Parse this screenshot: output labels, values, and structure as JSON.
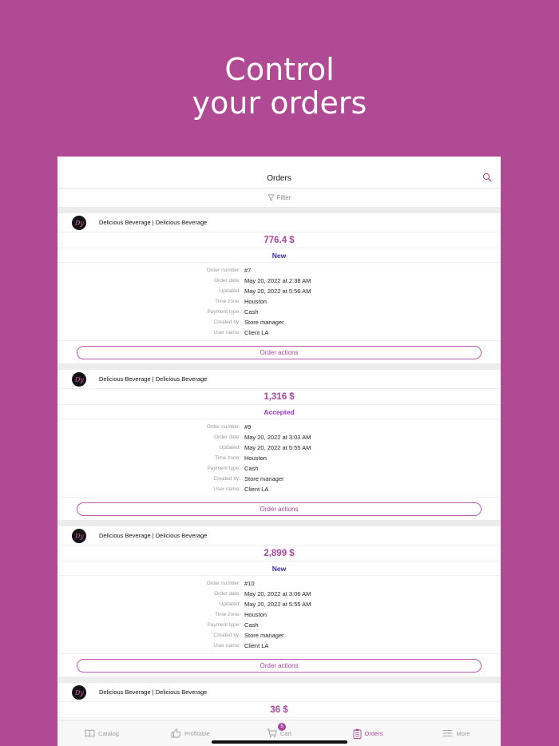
{
  "hero": {
    "line1": "Control",
    "line2": "your orders"
  },
  "nav": {
    "title": "Orders"
  },
  "filter": {
    "label": "Filter"
  },
  "labels": {
    "order_number": "Order number:",
    "order_date": "Order date:",
    "updated": "Updated:",
    "time_zone": "Time zone:",
    "payment_type": "Payment type:",
    "created_by": "Created by:",
    "user_name": "User name:",
    "actions": "Order actions"
  },
  "orders": [
    {
      "store": "Delicious Beverage  | Delicious Beverage",
      "amount": "776.4 $",
      "status": "New",
      "status_color": "#3b2fa3",
      "number": "#7",
      "date": "May 20, 2022 at 2:38 AM",
      "updated": "May 20, 2022 at 5:56 AM",
      "tz": "Houston",
      "payment": "Cash",
      "created_by": "Store manager",
      "user": "Client LA"
    },
    {
      "store": "Delicious Beverage  | Delicious Beverage",
      "amount": "1,316 $",
      "status": "Accepted",
      "status_color": "#a235c9",
      "number": "#9",
      "date": "May 20, 2022 at 3:03 AM",
      "updated": "May 20, 2022 at 5:55 AM",
      "tz": "Houston",
      "payment": "Cash",
      "created_by": "Store manager",
      "user": "Client LA"
    },
    {
      "store": "Delicious Beverage  | Delicious Beverage",
      "amount": "2,899 $",
      "status": "New",
      "status_color": "#3b2fa3",
      "number": "#10",
      "date": "May 20, 2022 at 3:06 AM",
      "updated": "May 20, 2022 at 5:55 AM",
      "tz": "Houston",
      "payment": "Cash",
      "created_by": "Store manager",
      "user": "Client LA"
    },
    {
      "store": "Delicious Beverage  | Delicious Beverage",
      "amount": "36 $"
    }
  ],
  "tabs": [
    {
      "label": "Catalog",
      "icon": "book-icon"
    },
    {
      "label": "Profitable",
      "icon": "thumbs-up-icon"
    },
    {
      "label": "Cart",
      "icon": "cart-icon",
      "badge": "5"
    },
    {
      "label": "Orders",
      "icon": "clipboard-icon",
      "active": true
    },
    {
      "label": "More",
      "icon": "menu-icon"
    }
  ],
  "colors": {
    "background": "#b04a95",
    "accent": "#a8479e"
  }
}
